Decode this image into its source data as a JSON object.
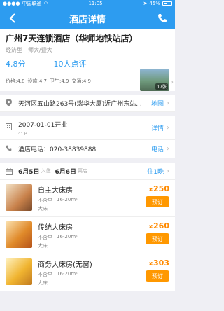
{
  "status": {
    "carrier": "中国联通",
    "time": "11:05",
    "battery": "45%"
  },
  "header": {
    "title": "酒店详情"
  },
  "hotel": {
    "name": "广州7天连锁酒店（华师地铁站店）",
    "type": "经济型",
    "area": "师大/暨大",
    "score": "4.8分",
    "reviews": "10人点评",
    "sub_scores": [
      "价格:4.8",
      "设施:4.7",
      "卫生:4.9",
      "交通:4.9"
    ],
    "photo_count": "17张"
  },
  "info_rows": [
    {
      "icon": "location-icon",
      "text": "天河区五山路263号(瑞华大厦)近广州东站...",
      "action": "地图"
    },
    {
      "icon": "building-icon",
      "text": "2007-01-01开业",
      "extra": "P",
      "action": "详情"
    },
    {
      "icon": "phone-icon",
      "text": "酒店电话：020-38839888",
      "action": "电话"
    }
  ],
  "dates": {
    "checkin": "6月5日",
    "checkin_label": "入住",
    "checkout": "6月6日",
    "checkout_label": "离店",
    "nights": "住1晚"
  },
  "rooms": [
    {
      "name": "自主大床房",
      "breakfast": "不含早",
      "size": "16-20m²",
      "bed": "大床",
      "price": "250",
      "currency": "¥",
      "book": "预订",
      "img_color": "#c8814a"
    },
    {
      "name": "传统大床房",
      "breakfast": "不含早",
      "size": "16-20m²",
      "bed": "大床",
      "price": "260",
      "currency": "¥",
      "book": "预订",
      "img_color": "#e08a2a"
    },
    {
      "name": "商务大床房(无窗)",
      "breakfast": "不含早",
      "size": "16-20m²",
      "bed": "大床",
      "price": "303",
      "currency": "¥",
      "book": "预订",
      "img_color": "#f0b430"
    }
  ],
  "colors": {
    "primary": "#2d9cf0",
    "price": "#ff8a00",
    "book": "#ff9800"
  }
}
